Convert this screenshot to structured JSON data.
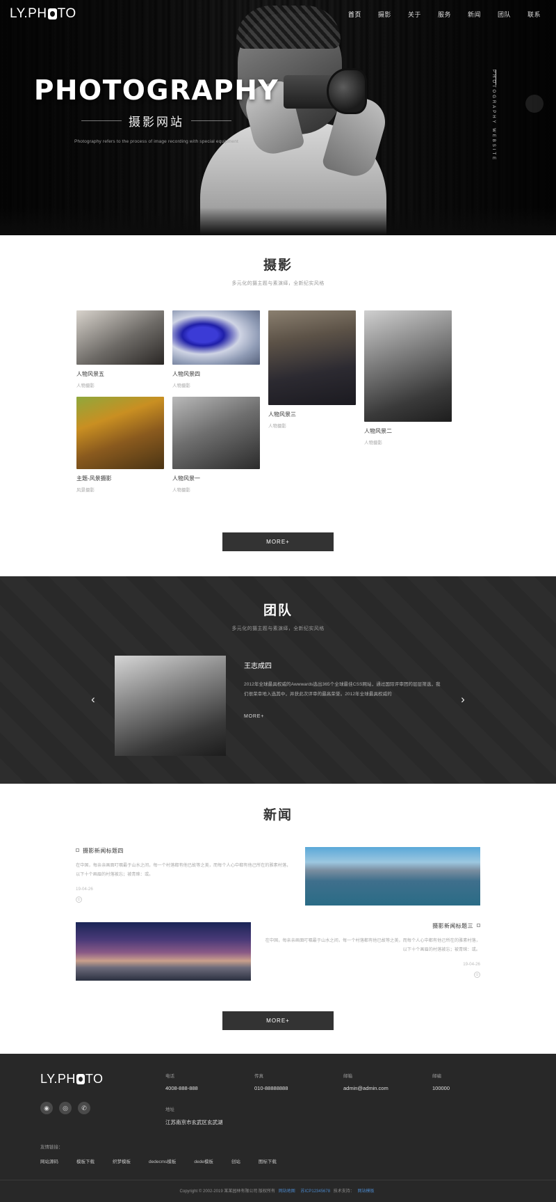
{
  "header": {
    "logo_pre": "LY.PH",
    "logo_post": "TO",
    "nav": [
      {
        "label": "首页"
      },
      {
        "label": "摄影"
      },
      {
        "label": "关于"
      },
      {
        "label": "服务"
      },
      {
        "label": "新闻"
      },
      {
        "label": "团队"
      },
      {
        "label": "联系"
      }
    ]
  },
  "hero": {
    "title": "PHOTOGRAPHY",
    "subtitle": "摄影网站",
    "description": "Photography refers to the process of image recording with special equipment",
    "vertical_label": "PHOTOGRAPHY WEBSITE"
  },
  "photography": {
    "title": "摄影",
    "subtitle": "多元化的摄主题与素演绎，全新纪实风格",
    "items": [
      {
        "name": "人物风景五",
        "tag": "人物摄影"
      },
      {
        "name": "人物风景四",
        "tag": "人物摄影"
      },
      {
        "name": "人物风景三",
        "tag": "人物摄影"
      },
      {
        "name": "人物风景二",
        "tag": "人物摄影"
      },
      {
        "name": "主题-风景摄影",
        "tag": "风景摄影"
      },
      {
        "name": "人物风景一",
        "tag": "人物摄影"
      }
    ],
    "more_label": "MORE+"
  },
  "team": {
    "title": "团队",
    "subtitle": "多元化的摄主题与素演绎，全新纪实风格",
    "member_name": "王志成四",
    "member_desc": "2012年全球最具权威的Awwwards选出365个全球最佳CSS网站，通过国际评审团的层层筛选，我们很荣幸地入选其中，并获此次评审的最高荣誉。2012年全球最具权威的",
    "more_label": "MORE+",
    "prev_icon": "chevron-left",
    "next_icon": "chevron-right"
  },
  "news": {
    "title": "新闻",
    "items": [
      {
        "title": "摄影新闻标题四",
        "desc": "在中国，每亲亲画面叮嘱最于山水之间，每一个村落都有他已故等之美，而每个人心中都有他己所在的雅素村落，以下十个画眉的村落被忘；被青睐：或。",
        "date": "19-04-26",
        "circle": "①"
      },
      {
        "title": "摄影新闻标题三",
        "desc": "在中国，每亲亲画面叮嘱最于山水之间，每一个村落都有他已故等之美，而每个人心中都有他己所在的雅素村落，以下十个画眉的村落被忘；被青睐：或。",
        "date": "19-04-26",
        "circle": "①"
      }
    ],
    "more_label": "MORE+"
  },
  "footer": {
    "logo_pre": "LY.PH",
    "logo_post": "TO",
    "socials": [
      {
        "icon": "weibo-icon",
        "glyph": "◉"
      },
      {
        "icon": "qq-icon",
        "glyph": "◎"
      },
      {
        "icon": "wechat-icon",
        "glyph": "✆"
      }
    ],
    "contacts": [
      {
        "label": "电话",
        "value": "4008-888-888"
      },
      {
        "label": "传真",
        "value": "010-88888888"
      },
      {
        "label": "邮箱",
        "value": "admin@admin.com"
      },
      {
        "label": "邮编",
        "value": "100000"
      }
    ],
    "address_label": "地址",
    "address_value": "江苏南京市玄武区玄武湖",
    "links_label": "友情链接：",
    "links": [
      {
        "label": "网站源码"
      },
      {
        "label": "模板下载"
      },
      {
        "label": "织梦模板"
      },
      {
        "label": "dedecms模板"
      },
      {
        "label": "dede模板"
      },
      {
        "label": "创站"
      },
      {
        "label": "图标下载"
      }
    ],
    "copyright": "Copyright © 2002-2019 某某园林有限公司 版权所有",
    "copy_links": [
      {
        "label": "网站地图"
      },
      {
        "label": "苏ICP12345678"
      },
      {
        "label": "网站模板"
      }
    ],
    "copy_mid": "技术支持："
  },
  "colors": {
    "dark": "#282828",
    "team_bg": "#2a2a2a",
    "accent": "#4a86c8",
    "button": "#333333"
  }
}
